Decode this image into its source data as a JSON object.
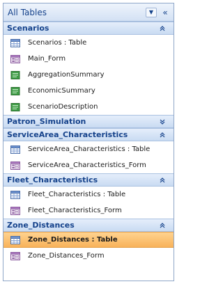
{
  "pane": {
    "title": "All Tables",
    "menu_glyph": "▼",
    "shutter_glyph": "«"
  },
  "groups": [
    {
      "label": "Scenarios",
      "expanded": true,
      "items": [
        {
          "label": "Scenarios : Table",
          "icon": "table-icon"
        },
        {
          "label": "Main_Form",
          "icon": "form-icon"
        },
        {
          "label": "AggregationSummary",
          "icon": "report-icon"
        },
        {
          "label": "EconomicSummary",
          "icon": "report-icon"
        },
        {
          "label": "ScenarioDescription",
          "icon": "report-icon"
        }
      ]
    },
    {
      "label": "Patron_Simulation",
      "expanded": false,
      "items": []
    },
    {
      "label": "ServiceArea_Characteristics",
      "expanded": true,
      "items": [
        {
          "label": "ServiceArea_Characteristics : Table",
          "icon": "table-icon"
        },
        {
          "label": "ServiceArea_Characteristics_Form",
          "icon": "form-icon"
        }
      ]
    },
    {
      "label": "Fleet_Characteristics",
      "expanded": true,
      "items": [
        {
          "label": "Fleet_Characteristics : Table",
          "icon": "table-icon"
        },
        {
          "label": "Fleet_Characteristics_Form",
          "icon": "form-icon"
        }
      ]
    },
    {
      "label": "Zone_Distances",
      "expanded": true,
      "items": [
        {
          "label": "Zone_Distances : Table",
          "icon": "table-icon",
          "selected": true
        },
        {
          "label": "Zone_Distances_Form",
          "icon": "form-icon"
        }
      ]
    }
  ],
  "colors": {
    "header_text": "#15428b",
    "selection": "#f8b25a",
    "group_bg": "#c9dbf2"
  }
}
